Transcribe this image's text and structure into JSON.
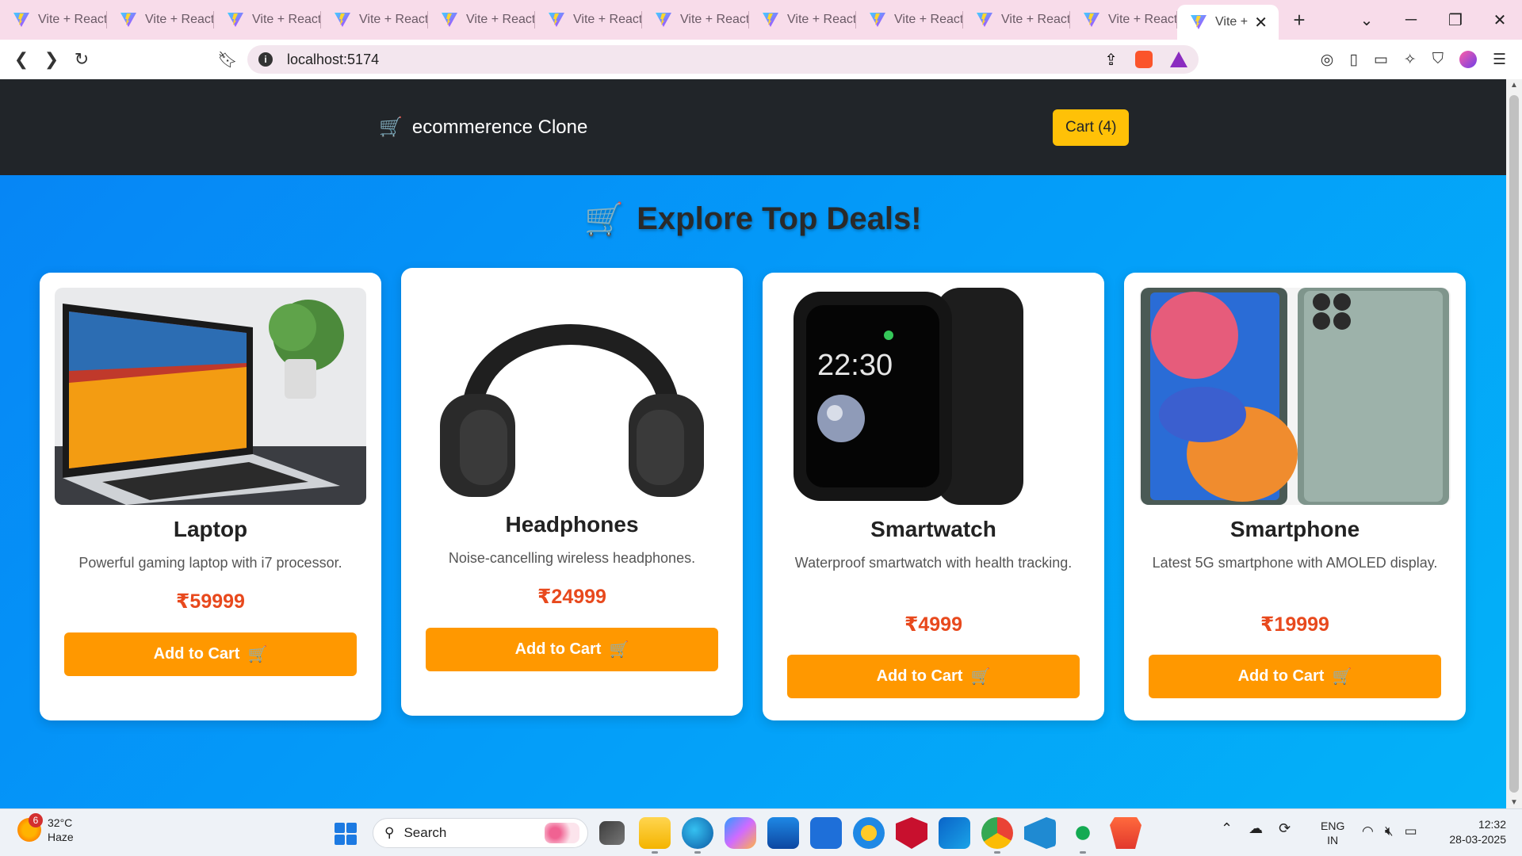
{
  "browser": {
    "tabs": [
      {
        "title": "Vite + React"
      },
      {
        "title": "Vite + React"
      },
      {
        "title": "Vite + React"
      },
      {
        "title": "Vite + React"
      },
      {
        "title": "Vite + React"
      },
      {
        "title": "Vite + React"
      },
      {
        "title": "Vite + React"
      },
      {
        "title": "Vite + React"
      },
      {
        "title": "Vite + React"
      },
      {
        "title": "Vite + React"
      },
      {
        "title": "Vite + React"
      }
    ],
    "active_tab": {
      "title": "Vite +",
      "close": "✕"
    },
    "new_tab": "+",
    "url": "localhost:5174",
    "accent": "#f8dcea"
  },
  "site": {
    "brand_icon": "🛒",
    "brand_name": "ecommerence Clone",
    "cart_label": "Cart (4)",
    "hero_icon": "🛒",
    "hero_title": "Explore Top Deals!"
  },
  "products": [
    {
      "name": "Laptop",
      "description": "Powerful gaming laptop with i7 processor.",
      "price": "₹59999",
      "button": "Add to Cart",
      "button_icon": "🛒"
    },
    {
      "name": "Headphones",
      "description": "Noise-cancelling wireless headphones.",
      "price": "₹24999",
      "button": "Add to Cart",
      "button_icon": "🛒"
    },
    {
      "name": "Smartwatch",
      "description": "Waterproof smartwatch with health tracking.",
      "price": "₹4999",
      "button": "Add to Cart",
      "button_icon": "🛒",
      "watch_time": "22:30"
    },
    {
      "name": "Smartphone",
      "description": "Latest 5G smartphone with AMOLED display.",
      "price": "₹19999",
      "button": "Add to Cart",
      "button_icon": "🛒"
    }
  ],
  "taskbar": {
    "weather_temp": "32°C",
    "weather_desc": "Haze",
    "weather_badge": "6",
    "search_label": "Search",
    "language": "ENG",
    "region": "IN",
    "time": "12:32",
    "date": "28-03-2025"
  }
}
